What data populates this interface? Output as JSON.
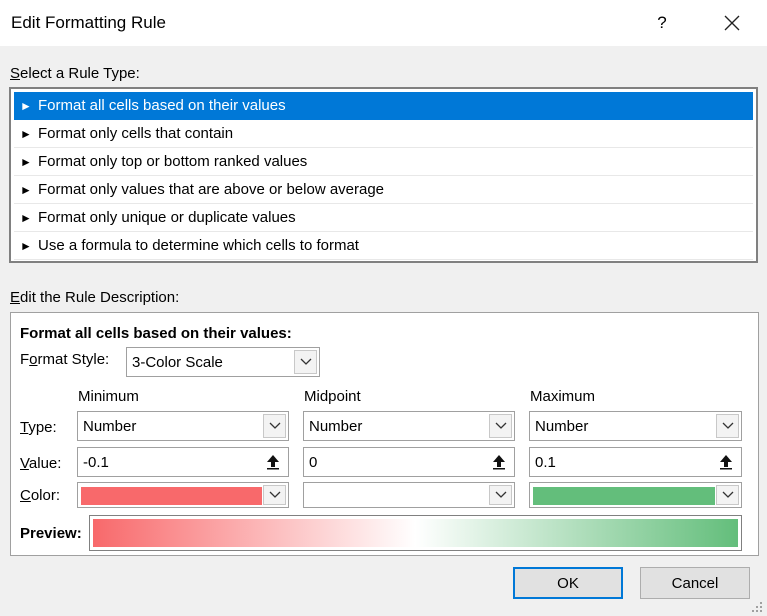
{
  "dialog": {
    "title": "Edit Formatting Rule",
    "help_label": "?",
    "close_icon": "close-icon"
  },
  "rule_type": {
    "label_accel": "S",
    "label_rest": "elect a Rule Type:",
    "arrow_glyph": "►",
    "items": [
      {
        "label": "Format all cells based on their values",
        "selected": true
      },
      {
        "label": "Format only cells that contain",
        "selected": false
      },
      {
        "label": "Format only top or bottom ranked values",
        "selected": false
      },
      {
        "label": "Format only values that are above or below average",
        "selected": false
      },
      {
        "label": "Format only unique or duplicate values",
        "selected": false
      },
      {
        "label": "Use a formula to determine which cells to format",
        "selected": false
      }
    ]
  },
  "description": {
    "label_accel": "E",
    "label_rest": "dit the Rule Description:",
    "heading": "Format all cells based on their values:",
    "format_style": {
      "label_pre": "F",
      "label_accel": "o",
      "label_rest": "rmat Style:",
      "value": "3-Color Scale"
    },
    "columns": {
      "minimum": "Minimum",
      "midpoint": "Midpoint",
      "maximum": "Maximum"
    },
    "row_labels": {
      "type_accel": "T",
      "type_rest": "ype:",
      "value_accel": "V",
      "value_rest": "alue:",
      "color_accel": "C",
      "color_rest": "olor:"
    },
    "minimum": {
      "type": "Number",
      "value": "-0.1",
      "color": "#f8696b"
    },
    "midpoint": {
      "type": "Number",
      "value": "0",
      "color": "#ffffff"
    },
    "maximum": {
      "type": "Number",
      "value": "0.1",
      "color": "#63be7b"
    },
    "preview_label": "Preview:"
  },
  "buttons": {
    "ok": "OK",
    "cancel": "Cancel"
  },
  "colors": {
    "selection": "#0078d7",
    "min_color": "#f8696b",
    "mid_color": "#ffffff",
    "max_color": "#63be7b"
  }
}
